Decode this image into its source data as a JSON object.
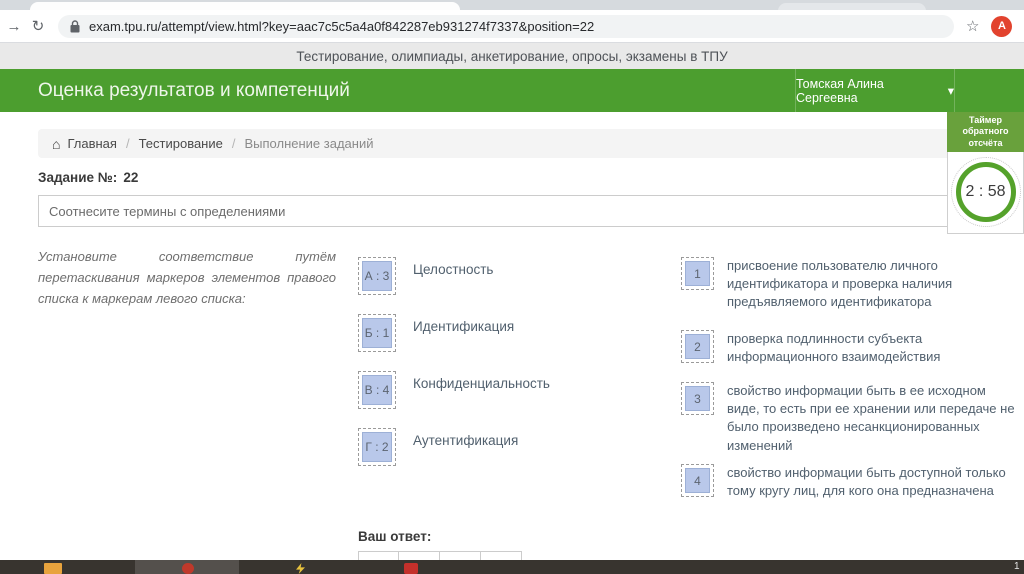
{
  "browser": {
    "url": "exam.tpu.ru/attempt/view.html?key=aac7c5c5a4a0f842287eb931274f7337&position=22",
    "avatar_letter": "A"
  },
  "icons": {
    "forward": "→",
    "reload": "↻",
    "star": "☆",
    "home": "⌂",
    "caret": "▾"
  },
  "banner": {
    "text": "Тестирование, олимпиады, анкетирование, опросы, экзамены в ТПУ"
  },
  "header": {
    "title": "Оценка результатов и компетенций",
    "user": "Томская Алина Сергеевна"
  },
  "timer": {
    "label": "Таймер обратного отсчёта",
    "value": "2 : 58"
  },
  "breadcrumb": {
    "items": [
      "Главная",
      "Тестирование",
      "Выполнение заданий"
    ],
    "separator": "/"
  },
  "task": {
    "number_label": "Задание №:",
    "number": "22",
    "question": "Соотнесите термины с определениями",
    "instruction": "Установите соответствие путём перетаскивания маркеров элементов правого списка к маркерам левого списка:",
    "left_list": [
      {
        "marker": "А : 3",
        "term": "Целостность"
      },
      {
        "marker": "Б : 1",
        "term": "Идентификация"
      },
      {
        "marker": "В : 4",
        "term": "Конфиденциальность"
      },
      {
        "marker": "Г : 2",
        "term": "Аутентификация"
      }
    ],
    "right_list": [
      {
        "marker": "1",
        "text": "присвоение пользователю личного идентификатора и проверка наличия предъявляемого идентификатора"
      },
      {
        "marker": "2",
        "text": "проверка подлинности субъекта информационного взаимодействия"
      },
      {
        "marker": "3",
        "text": "свойство информации быть в ее исходном виде, то есть при ее хранении или передаче не было произведено несанкционированных изменений"
      },
      {
        "marker": "4",
        "text": "свойство информации быть доступной только тому кругу лиц, для кого она предназначена"
      }
    ],
    "answer_label": "Ваш ответ:"
  },
  "taskbar": {
    "clock": "1"
  },
  "colors": {
    "header_green": "#4c9e2f",
    "timer_green": "#69a13c",
    "marker_fill": "#b9c8ea",
    "avatar_red": "#e2432e"
  }
}
